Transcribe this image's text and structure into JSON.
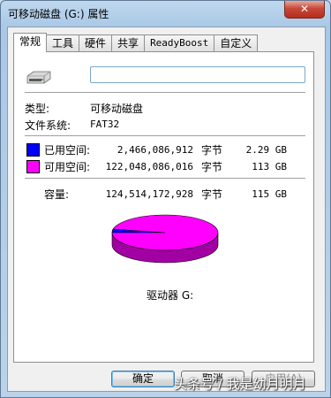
{
  "window": {
    "title": "可移动磁盘 (G:) 属性",
    "close_glyph": "✕"
  },
  "tabs": [
    "常规",
    "工具",
    "硬件",
    "共享",
    "ReadyBoost",
    "自定义"
  ],
  "general": {
    "name_value": "",
    "type_label": "类型:",
    "type_value": "可移动磁盘",
    "fs_label": "文件系统:",
    "fs_value": "FAT32",
    "used": {
      "label": "已用空间:",
      "bytes": "2,466,086,912",
      "unit": "字节",
      "size": "2.29 GB",
      "color": "#0000ff"
    },
    "free": {
      "label": "可用空间:",
      "bytes": "122,048,086,016",
      "unit": "字节",
      "size": "113 GB",
      "color": "#ff00ff"
    },
    "capacity": {
      "label": "容量:",
      "bytes": "124,514,172,928",
      "unit": "字节",
      "size": "115 GB"
    },
    "drive_label": "驱动器 G:"
  },
  "usage": {
    "used_fraction": 0.0198,
    "used_color": "#0000ff",
    "free_color": "#ff00ff"
  },
  "buttons": {
    "ok": "确定",
    "cancel": "取消",
    "apply": "应用(A)"
  },
  "watermark": "头条号 / 我是幼月明月"
}
